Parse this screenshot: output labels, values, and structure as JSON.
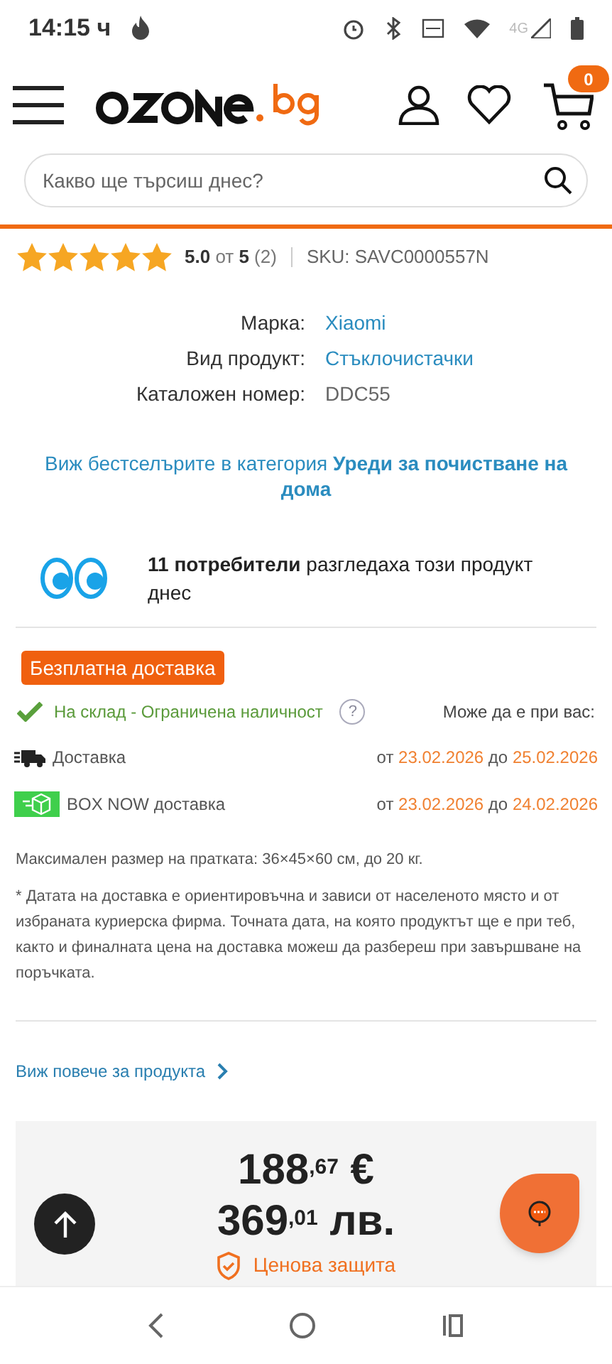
{
  "status_bar": {
    "time": "14:15 ч",
    "network": "4G"
  },
  "header": {
    "cart_count": "0"
  },
  "search": {
    "placeholder": "Какво ще търсиш днес?"
  },
  "rating": {
    "stars": 5,
    "score": "5.0",
    "of": "от",
    "max": "5",
    "count": "(2)",
    "sku": "SKU: SAVC0000557N"
  },
  "specs": [
    {
      "label": "Марка:",
      "value": "Xiaomi",
      "kind": "link"
    },
    {
      "label": "Вид продукт:",
      "value": "Стъклочистачки",
      "kind": "link"
    },
    {
      "label": "Каталожен номер:",
      "value": "DDC55",
      "kind": "plain"
    }
  ],
  "bestsellers": "Виж бестселърите в категория **Уреди за почистване на дома**",
  "viewers": "**11 потребители** разгледаха този продукт днес",
  "free_shipping": "Безплатна доставка",
  "stock": {
    "text": "На склад - Ограничена наличност",
    "help": "?",
    "arrival": "Може да е при вас:"
  },
  "delivery": [
    {
      "kind": "truck",
      "name": "Доставка",
      "from": "от",
      "date_from": "23.02.2026",
      "to": "до",
      "date_to": "25.02.2026"
    },
    {
      "kind": "box",
      "name": "BOX NOW доставка",
      "from": "от",
      "date_from": "23.02.2026",
      "to": "до",
      "date_to": "24.02.2026"
    }
  ],
  "max_size": "Максимален размер на пратката: 36×45×60 см, до 20 кг.",
  "note": "* Датата на доставка е ориентировъчна и зависи от населеното място и от избраната куриерска фирма. Точната дата, на която продуктът ще е при теб, както и финалната цена на доставка можеш да разбереш при завършване на поръчката.",
  "see_more": "Виж повече за продукта",
  "price": {
    "eur": "188$^{,67}$ €",
    "bgn": "369$^{,01}$ лв.",
    "protection": "Ценова защита"
  }
}
